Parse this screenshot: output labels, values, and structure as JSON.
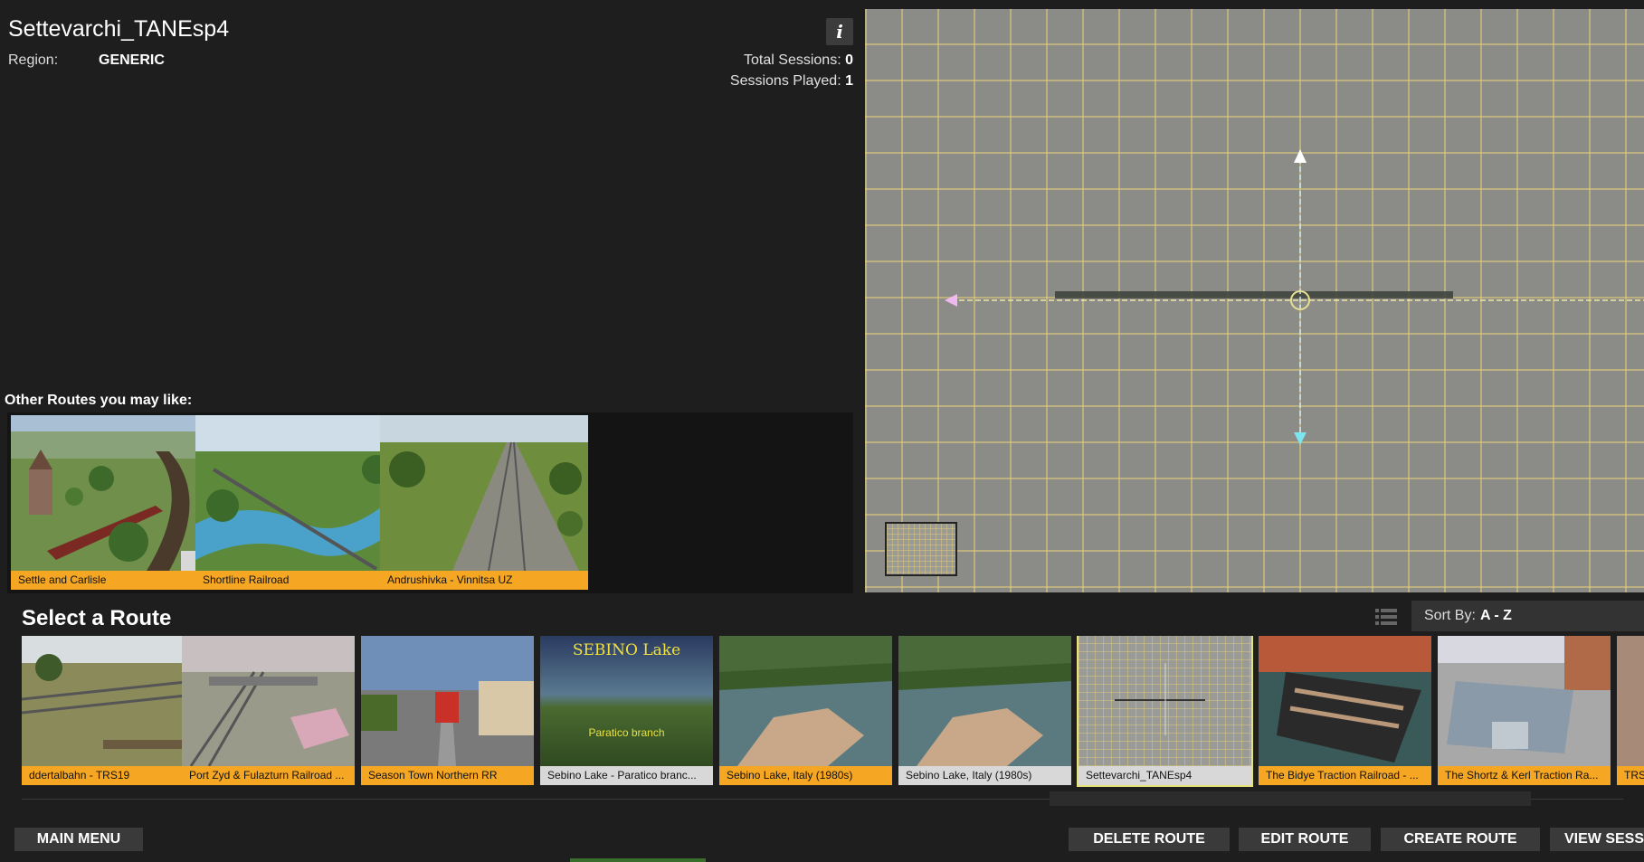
{
  "header": {
    "route_name": "Settevarchi_TANEsp4",
    "region_label": "Region:",
    "region_value": "GENERIC",
    "info_icon": "info-icon",
    "total_sessions_label": "Total Sessions:",
    "total_sessions_value": "0",
    "sessions_played_label": "Sessions Played:",
    "sessions_played_value": "1"
  },
  "recommendations": {
    "title": "Other Routes you may like:",
    "items": [
      {
        "label": "Settle and Carlisle"
      },
      {
        "label": "Shortline Railroad"
      },
      {
        "label": "Andrushivka - Vinnitsa UZ"
      }
    ]
  },
  "route_list": {
    "title": "Select a Route",
    "sort_label": "Sort By:",
    "sort_value": "A - Z",
    "items": [
      {
        "label": "ddertalbahn - TRS19"
      },
      {
        "label": "Port Zyd & Fulazturn Railroad ..."
      },
      {
        "label": "Season Town Northern RR"
      },
      {
        "label": "Sebino Lake - Paratico branc...",
        "thumb_title": "SEBINO Lake",
        "thumb_subtitle": "Paratico branch"
      },
      {
        "label": "Sebino Lake, Italy (1980s)"
      },
      {
        "label": "Sebino Lake, Italy (1980s)"
      },
      {
        "label": "Settevarchi_TANEsp4",
        "selected": true
      },
      {
        "label": "The Bidye Traction Railroad - ..."
      },
      {
        "label": "The Shortz & Kerl Traction Ra..."
      },
      {
        "label": "TRS"
      }
    ]
  },
  "buttons": {
    "main_menu": "MAIN MENU",
    "delete_route": "DELETE ROUTE",
    "edit_route": "EDIT ROUTE",
    "create_route": "CREATE ROUTE",
    "view_sessions": "VIEW SESS"
  },
  "colors": {
    "accent_label": "#f5a623",
    "selected_outline": "#e8e27a",
    "background": "#1e1e1e"
  }
}
